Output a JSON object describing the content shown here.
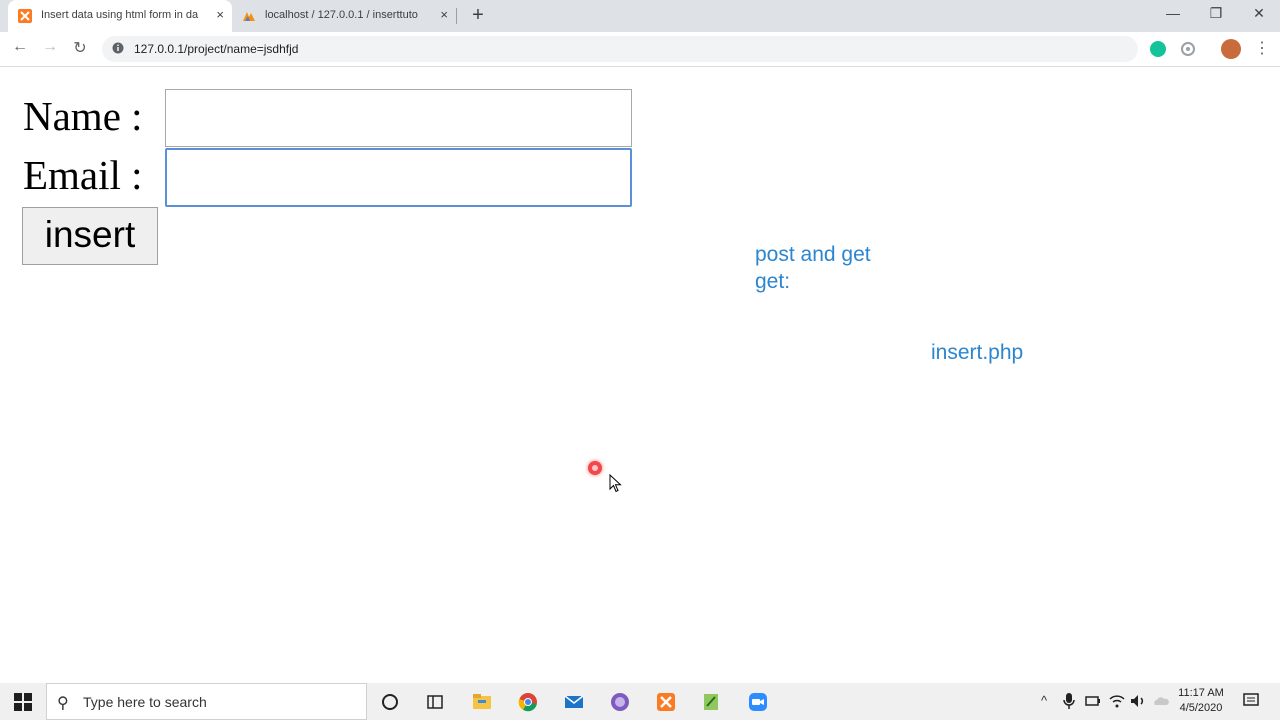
{
  "browser": {
    "tabs": [
      {
        "title": "Insert data using html form in da",
        "active": true,
        "close": "×"
      },
      {
        "title": "localhost / 127.0.0.1 / inserttuto",
        "active": false,
        "close": "×"
      }
    ],
    "new_tab": "+",
    "window_controls": {
      "minimize": "—",
      "restore": "❐",
      "close": "✕"
    },
    "nav": {
      "back": "←",
      "forward": "→",
      "reload": "↻"
    },
    "url": "127.0.0.1/project/name=jsdhfjd",
    "menu": "⋮",
    "colors": {
      "tabstrip": "#dee1e6",
      "accent": "#1a73e8"
    }
  },
  "form": {
    "name_label": "Name :",
    "name_value": "",
    "email_label": "Email :",
    "email_value": "",
    "submit_label": "insert"
  },
  "output": {
    "line1": "post and get",
    "line2": "get:",
    "file": "insert.php",
    "color": "#2b86cf"
  },
  "taskbar": {
    "search_placeholder": "Type here to search",
    "time": "11:17 AM",
    "date": "4/5/2020",
    "pinned": [
      "cortana-icon",
      "task-view-icon",
      "file-explorer-icon",
      "chrome-icon",
      "mail-icon",
      "browser-icon",
      "xampp-icon",
      "notepad-icon",
      "zoom-icon"
    ]
  }
}
